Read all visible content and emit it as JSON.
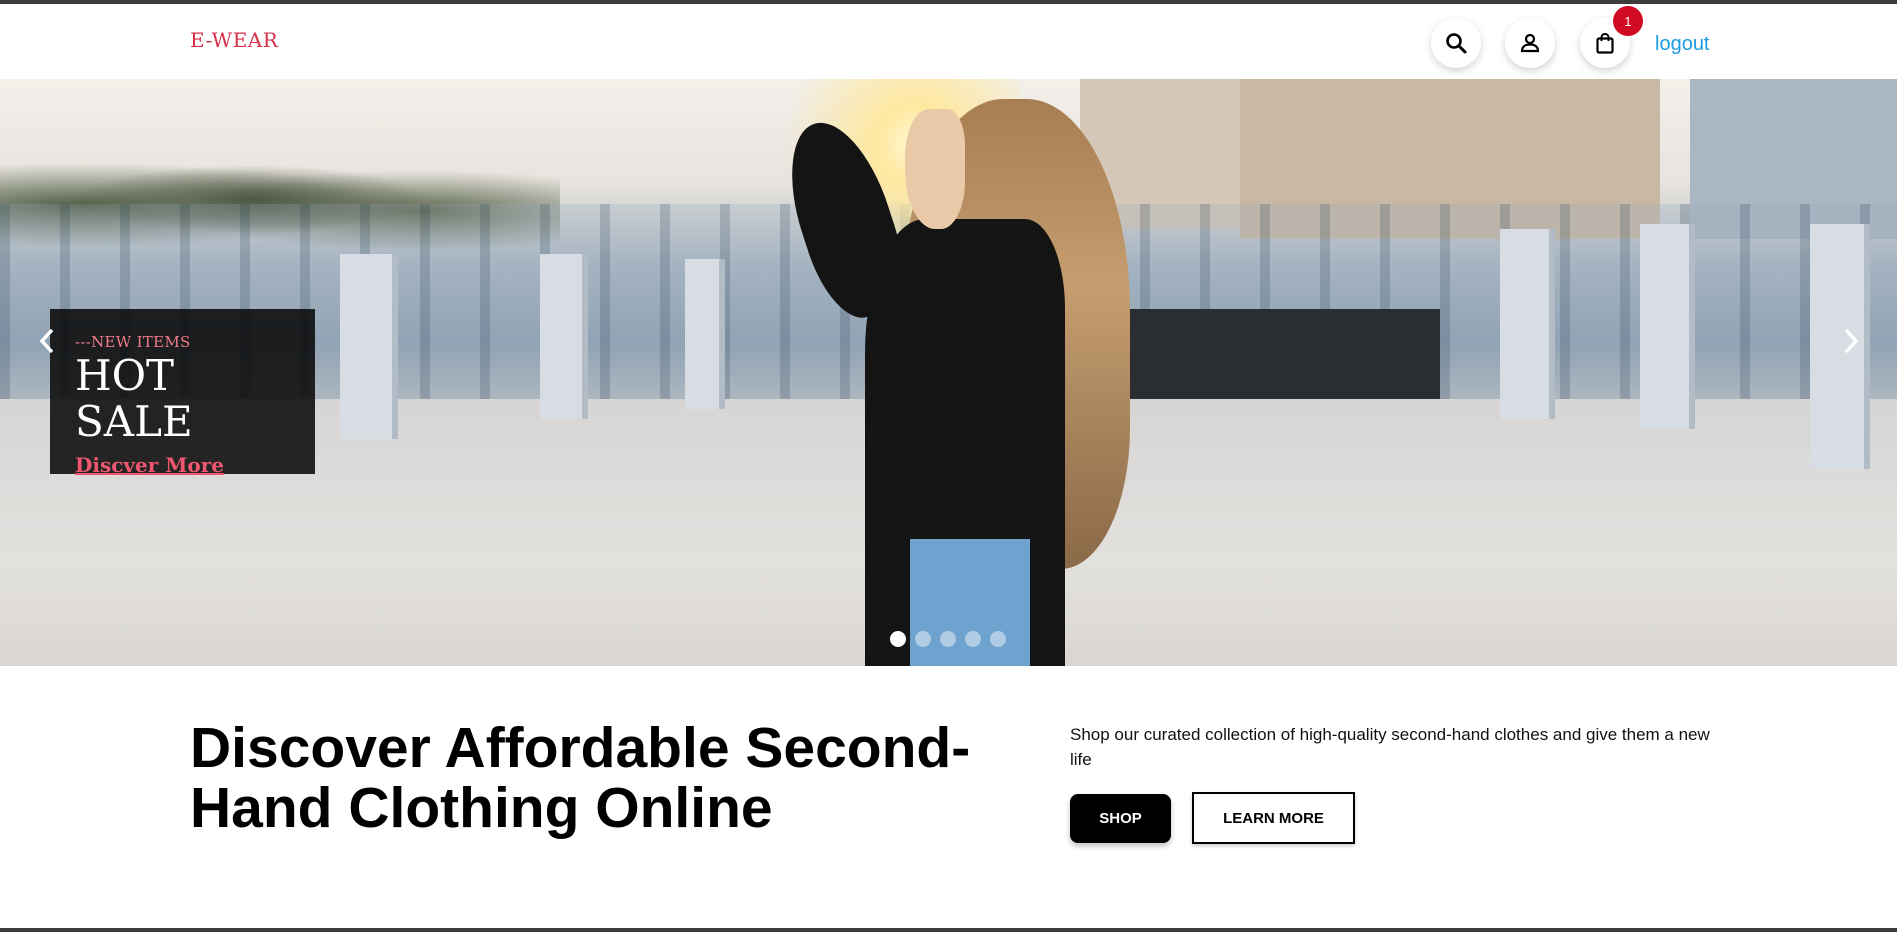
{
  "header": {
    "logo": "E-WEAR",
    "cart_count": "1",
    "logout_label": "logout",
    "icons": [
      "search-icon",
      "user-icon",
      "shopping-bag-icon"
    ]
  },
  "hero": {
    "kicker": "---NEW ITEMS",
    "title": "HOT SALE",
    "link_label": "Discver More",
    "slides_total": 5,
    "active_slide": 1
  },
  "intro": {
    "headline": "Discover Affordable Second-Hand Clothing Online",
    "description": "Shop our curated collection of high-quality second-hand clothes and give them a new life",
    "shop_label": "SHOP",
    "learn_more_label": "LEARN MORE"
  },
  "colors": {
    "logo": "#d6304a",
    "badge": "#cf0a22",
    "logout": "#1d9be0",
    "promo_link": "#f0566f"
  }
}
